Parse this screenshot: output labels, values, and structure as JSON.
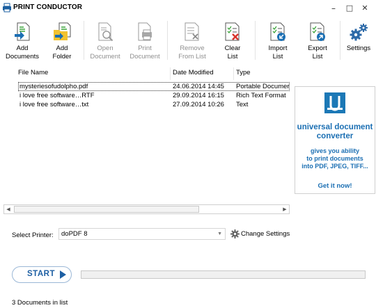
{
  "window": {
    "title": "PRINT CONDUCTOR",
    "controls": {
      "minimize": "–",
      "maximize": "□",
      "close": "✕"
    }
  },
  "toolbar": {
    "buttons": [
      {
        "label": "Add\nDocuments",
        "icon": "add-documents-icon",
        "enabled": true
      },
      {
        "label": "Add\nFolder",
        "icon": "add-folder-icon",
        "enabled": true
      },
      {
        "label": "Open\nDocument",
        "icon": "open-document-icon",
        "enabled": false
      },
      {
        "label": "Print\nDocument",
        "icon": "print-document-icon",
        "enabled": false
      },
      {
        "label": "Remove\nFrom List",
        "icon": "remove-from-list-icon",
        "enabled": false
      },
      {
        "label": "Clear\nList",
        "icon": "clear-list-icon",
        "enabled": true
      },
      {
        "label": "Import\nList",
        "icon": "import-list-icon",
        "enabled": true
      },
      {
        "label": "Export\nList",
        "icon": "export-list-icon",
        "enabled": true
      },
      {
        "label": "Settings",
        "icon": "settings-gears-icon",
        "enabled": true
      }
    ]
  },
  "file_list": {
    "columns": [
      "File Name",
      "Date Modified",
      "Type"
    ],
    "rows": [
      {
        "name": "mysteriesofudolpho.pdf",
        "date": "24.06.2014 14:45",
        "type": "Portable Documer",
        "selected": true
      },
      {
        "name": "i love free software…RTF",
        "date": "29.09.2014 16:15",
        "type": "Rich Text Format",
        "selected": false
      },
      {
        "name": "i love free software…txt",
        "date": "27.09.2014 10:26",
        "type": "Text",
        "selected": false
      }
    ]
  },
  "ad": {
    "title": "universal document converter",
    "text": "gives you ability\nto print documents\ninto PDF, JPEG, TIFF...",
    "cta": "Get it now!"
  },
  "printer": {
    "label": "Select Printer:",
    "selected": "doPDF 8",
    "change_settings": "Change Settings"
  },
  "start": {
    "label": "START"
  },
  "progress": {
    "fraction": 0
  },
  "status": "3 Documents in list",
  "colors": {
    "accent": "#1b6fb3",
    "link": "#1b78b6",
    "icon_green": "#3aa33a",
    "icon_red": "#d9342b"
  }
}
